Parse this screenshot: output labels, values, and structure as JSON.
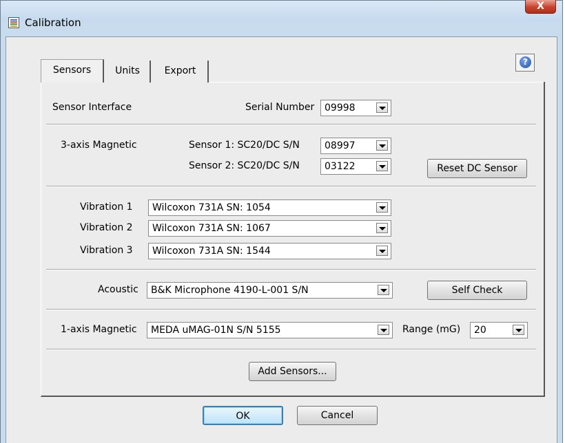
{
  "window": {
    "title": "Calibration",
    "close_label": "X"
  },
  "tabs": [
    {
      "label": "Sensors",
      "active": true
    },
    {
      "label": "Units",
      "active": false
    },
    {
      "label": "Export",
      "active": false
    }
  ],
  "help": {
    "icon": "help-icon",
    "glyph": "?"
  },
  "sensor_interface": {
    "label": "Sensor Interface",
    "serial_label": "Serial Number",
    "serial_value": "09998"
  },
  "magnetic_3axis": {
    "label": "3-axis Magnetic",
    "sensor1_label": "Sensor 1: SC20/DC S/N",
    "sensor1_value": "08997",
    "sensor2_label": "Sensor 2: SC20/DC S/N",
    "sensor2_value": "03122",
    "reset_button": "Reset DC Sensor"
  },
  "vibration": [
    {
      "label": "Vibration 1",
      "value": "Wilcoxon 731A SN: 1054"
    },
    {
      "label": "Vibration 2",
      "value": "Wilcoxon 731A SN: 1067"
    },
    {
      "label": "Vibration 3",
      "value": "Wilcoxon 731A SN: 1544"
    }
  ],
  "acoustic": {
    "label": "Acoustic",
    "value": "B&K Microphone 4190-L-001 S/N",
    "self_check_button": "Self Check"
  },
  "magnetic_1axis": {
    "label": "1-axis Magnetic",
    "value": "MEDA uMAG-01N S/N 5155",
    "range_label": "Range (mG)",
    "range_value": "20"
  },
  "add_sensors_button": "Add Sensors...",
  "footer": {
    "ok_button": "OK",
    "cancel_button": "Cancel"
  },
  "colors": {
    "frame": "#c9dced",
    "client": "#ececec",
    "close_button": "#c7432c",
    "ok_focus": "#3c7fb1"
  }
}
